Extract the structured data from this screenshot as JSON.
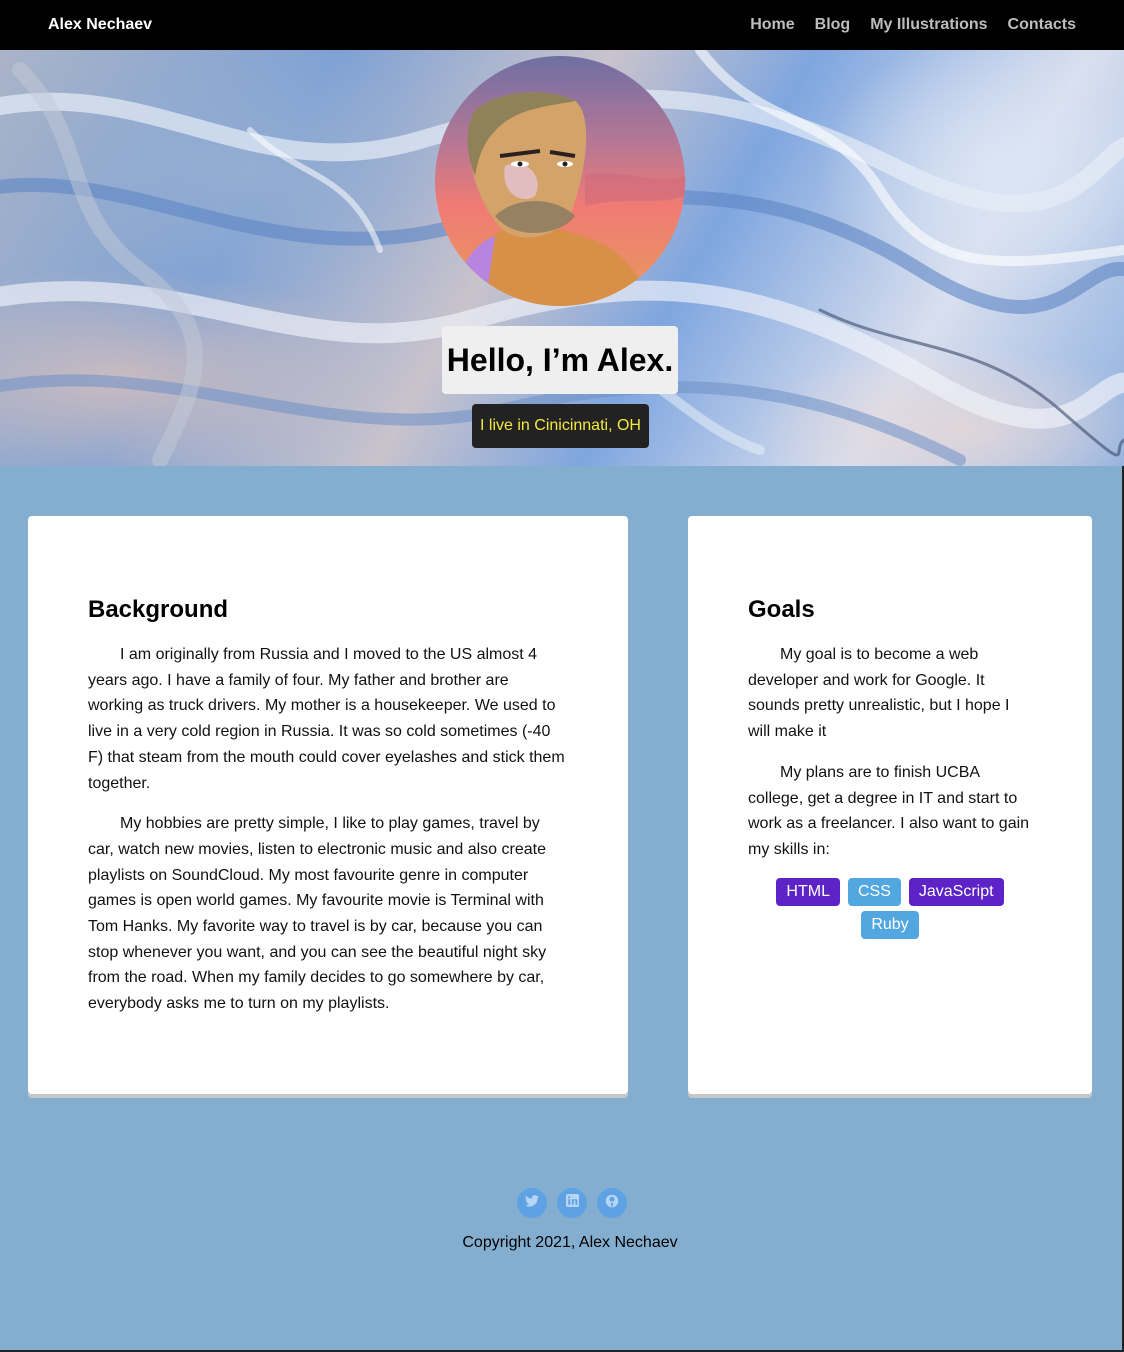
{
  "navbar": {
    "brand": "Alex Nechaev",
    "links": [
      "Home",
      "Blog",
      "My Illustrations",
      "Contacts"
    ]
  },
  "hero": {
    "title": "Hello, I’m Alex.",
    "subtitle": "I live in Cinicinnati, OH"
  },
  "background": {
    "heading": "Background",
    "paragraphs": [
      "I am originally from Russia and I moved to the US almost 4 years ago. I have a family of four. My father and brother are working as truck drivers. My mother is a housekeeper. We used to live in a very cold region in Russia. It was so cold sometimes (-40 F) that steam from the mouth could cover eyelashes and stick them together.",
      "My hobbies are pretty simple, I like to play games, travel by car, watch new movies, listen to electronic music and also create playlists on SoundCloud. My most favourite genre in computer games is open world games. My favourite movie is Terminal with Tom Hanks. My favorite way to travel is by car, because you can stop whenever you want, and you can see the beautiful night sky from the road. When my family decides to go somewhere by car, everybody asks me to turn on my playlists."
    ]
  },
  "goals": {
    "heading": "Goals",
    "paragraphs": [
      "My goal is to become a web developer and work for Google. It sounds pretty unrealistic, but I hope I will make it",
      "My plans are to finish UCBA college, get a degree in IT and start to work as a freelancer. I also want to gain my skills in:"
    ],
    "skills": [
      "HTML",
      "CSS",
      "JavaScript",
      "Ruby"
    ]
  },
  "footer": {
    "social_icons": [
      "twitter-icon",
      "linkedin-icon",
      "github-icon"
    ],
    "copyright": "Copyright 2021, Alex Nechaev"
  },
  "colors": {
    "page_bg": "#84aecf",
    "navbar_bg": "#000000",
    "subtitle_text": "#f4ea3f",
    "skill_purple": "#5e23c7",
    "skill_blue": "#52a7e0",
    "social_bg": "#5fa2e3"
  }
}
